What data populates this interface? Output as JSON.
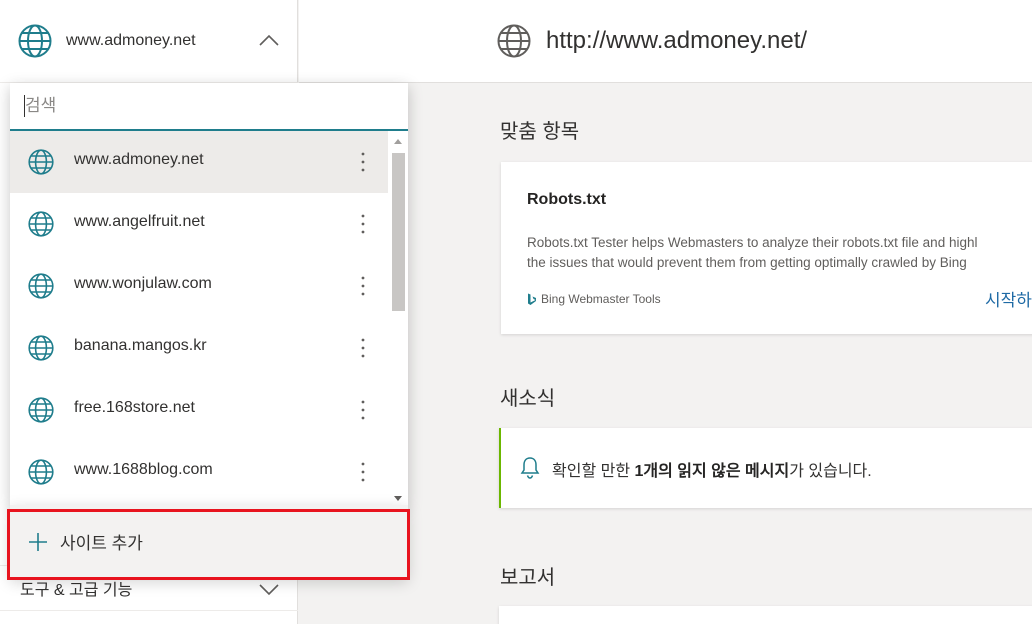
{
  "sidebar": {
    "current_site": "www.admoney.net",
    "site_icon": "globe-icon",
    "bottom_item": "도구 & 고급 기능"
  },
  "header": {
    "url": "http://www.admoney.net/"
  },
  "site_picker": {
    "search_placeholder": "검색",
    "sites": [
      {
        "label": "www.admoney.net",
        "selected": true
      },
      {
        "label": "www.angelfruit.net",
        "selected": false
      },
      {
        "label": "www.wonjulaw.com",
        "selected": false
      },
      {
        "label": "banana.mangos.kr",
        "selected": false
      },
      {
        "label": "free.168store.net",
        "selected": false
      },
      {
        "label": "www.1688blog.com",
        "selected": false
      }
    ],
    "add_site_label": "사이트 추가"
  },
  "recommendations": {
    "title": "맞춤 항목",
    "card_title": "Robots.txt",
    "card_desc_line1": "Robots.txt Tester helps Webmasters to analyze their robots.txt file and highl",
    "card_desc_line2": "the issues that would prevent them from getting optimally crawled by Bing",
    "card_source": "Bing Webmaster Tools",
    "card_action": "시작하"
  },
  "news": {
    "title": "새소식",
    "text_prefix": "확인할 만한 ",
    "text_bold": "1개의 읽지 않은 메시지",
    "text_suffix": "가 있습니다."
  },
  "reports": {
    "title": "보고서"
  },
  "colors": {
    "accent": "#1f7d8c",
    "globe": "#1f7d8c",
    "news_border": "#6bb700",
    "highlight": "#e8141f",
    "link": "#1f6aa5"
  }
}
